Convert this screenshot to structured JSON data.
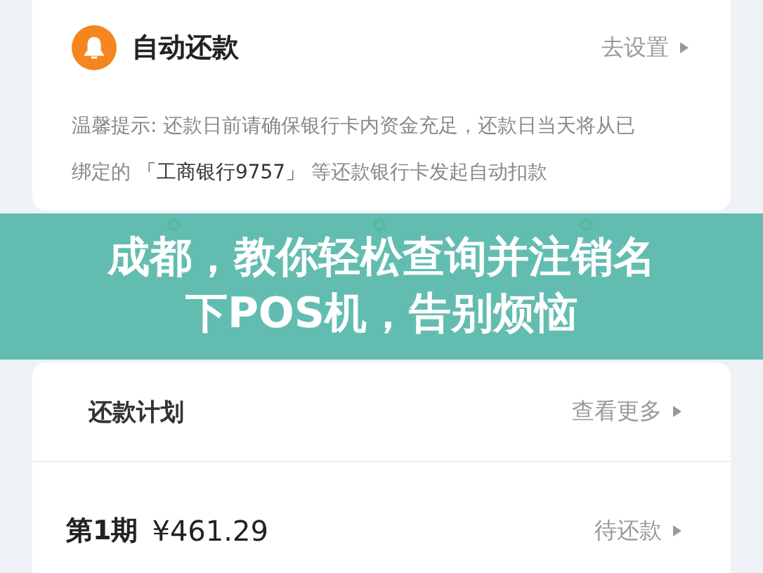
{
  "autopay": {
    "title": "自动还款",
    "action": "去设置",
    "notice_label": "温馨提示:",
    "notice_text": "还款日前请确保银行卡内资金充足，还款日当天将从已绑定的",
    "card": "「工商银行9757」",
    "notice_tail": "等还款银行卡发起自动扣款"
  },
  "steps": [
    {
      "kind": "dot"
    },
    {
      "kind": "dot"
    },
    {
      "kind": "dot"
    }
  ],
  "banner": {
    "lines": [
      "成都，教你轻松查询并注销名",
      "下POS机，告别烦恼"
    ]
  },
  "plan": {
    "title": "还款计划",
    "action": "查看更多"
  },
  "installments": [
    {
      "period": "第1期",
      "amount": "¥461.29",
      "status": "待还款"
    }
  ]
}
